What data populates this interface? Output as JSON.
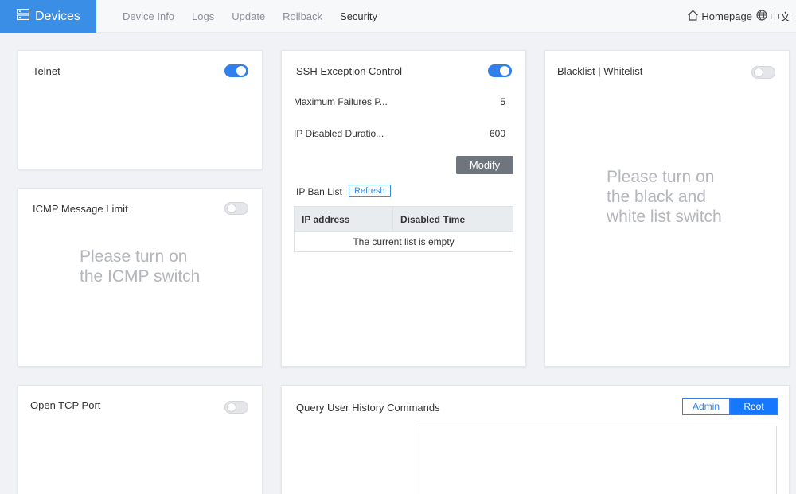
{
  "header": {
    "brand": "Devices",
    "nav": [
      "Device Info",
      "Logs",
      "Update",
      "Rollback",
      "Security"
    ],
    "active_nav": "Security",
    "homepage": "Homepage",
    "language": "中文"
  },
  "telnet": {
    "title": "Telnet",
    "enabled": true
  },
  "icmp": {
    "title": "ICMP Message Limit",
    "enabled": false,
    "placeholder": "Please turn on the ICMP switch"
  },
  "ssh": {
    "title": "SSH Exception Control",
    "enabled": true,
    "max_failures_label": "Maximum Failures P...",
    "max_failures_value": "5",
    "disabled_duration_label": "IP Disabled Duratio...",
    "disabled_duration_value": "600",
    "modify_label": "Modify",
    "ban_list_label": "IP Ban List",
    "refresh_label": "Refresh",
    "table_headers": [
      "IP address",
      "Disabled Time"
    ],
    "empty_message": "The current list is empty"
  },
  "blacklist": {
    "title": "Blacklist | Whitelist",
    "enabled": false,
    "placeholder": "Please turn on the black and white list switch"
  },
  "tcp": {
    "title": "Open TCP Port",
    "enabled": false
  },
  "history": {
    "title": "Query User History Commands",
    "users": [
      "Admin",
      "Root"
    ],
    "selected_user": "Root"
  },
  "colors": {
    "brand": "#3a8ee6",
    "toggle_on": "#2f80ed",
    "primary": "#1677ff"
  }
}
